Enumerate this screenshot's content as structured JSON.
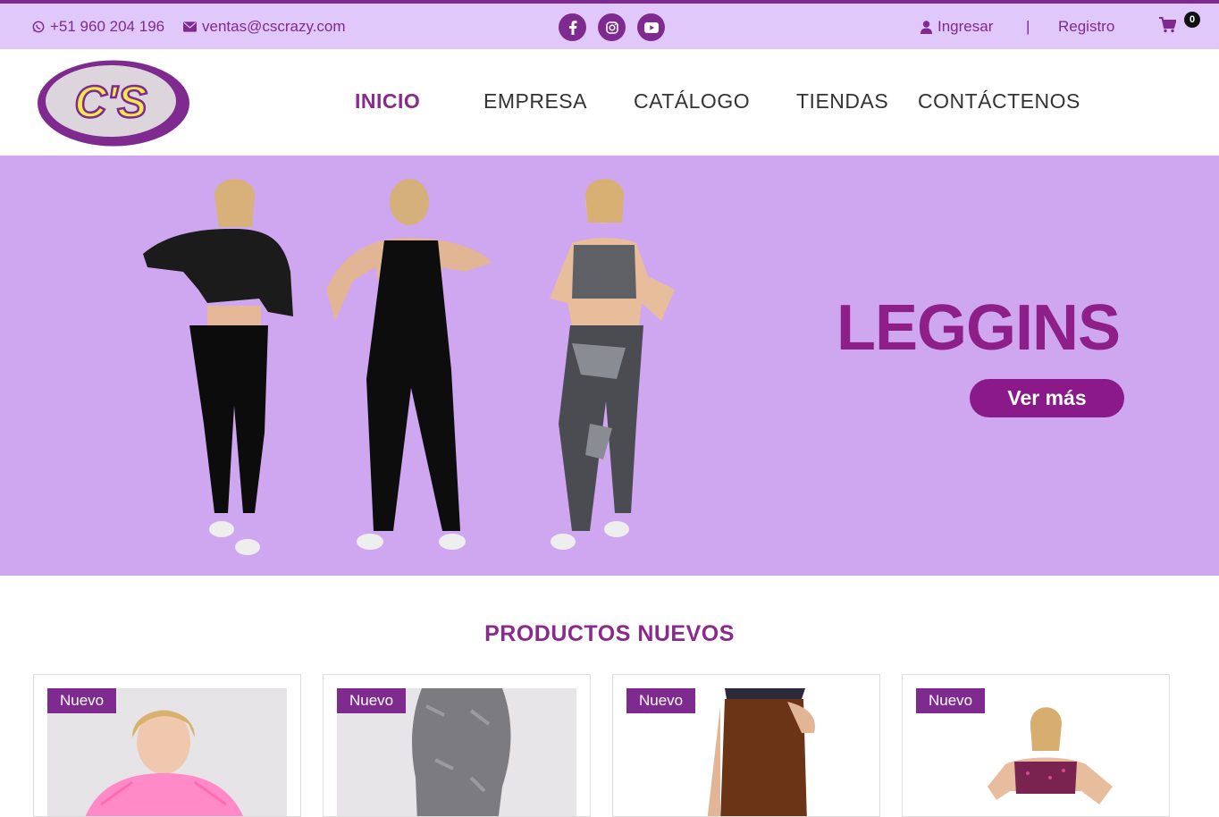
{
  "topbar": {
    "phone": "+51 960 204 196",
    "email": "ventas@cscrazy.com",
    "login": "Ingresar",
    "separator": "|",
    "register": "Registro",
    "cart_count": "0"
  },
  "nav": {
    "items": [
      "INICIO",
      "EMPRESA",
      "CATÁLOGO",
      "TIENDAS",
      "CONTÁCTENOS"
    ],
    "active": "INICIO"
  },
  "logo": {
    "text": "C'S"
  },
  "hero": {
    "title": "LEGGINS",
    "button": "Ver más"
  },
  "products": {
    "title": "PRODUCTOS NUEVOS",
    "badges": [
      "Nuevo",
      "Nuevo",
      "Nuevo",
      "Nuevo"
    ]
  },
  "colors": {
    "brand": "#7e2a8e",
    "topbar_bg": "#e0c8fb",
    "hero_bg": "#cfa6f0",
    "logo_yellow": "#f5e84a"
  }
}
